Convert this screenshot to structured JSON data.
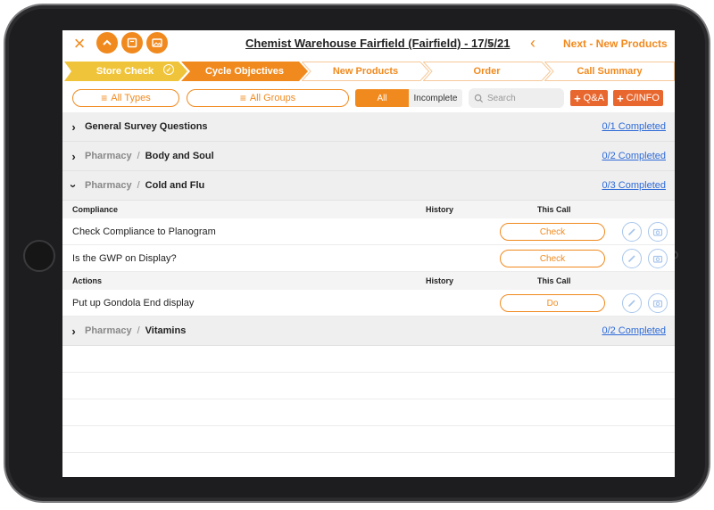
{
  "header": {
    "title": "Chemist Warehouse Fairfield (Fairfield) - 17/5/21",
    "next_label": "Next - New Products"
  },
  "steps": [
    {
      "label": "Store Check",
      "state": "done"
    },
    {
      "label": "Cycle Objectives",
      "state": "active"
    },
    {
      "label": "New Products",
      "state": "pending"
    },
    {
      "label": "Order",
      "state": "pending"
    },
    {
      "label": "Call Summary",
      "state": "pending"
    }
  ],
  "filters": {
    "types_label": "All Types",
    "groups_label": "All Groups",
    "seg_all": "All",
    "seg_incomplete": "Incomplete",
    "search_placeholder": "Search",
    "qa_label": "Q&A",
    "cinfo_label": "C/INFO"
  },
  "groups": [
    {
      "category": "",
      "name": "General Survey Questions",
      "completed": "0/1 Completed",
      "expanded": false
    },
    {
      "category": "Pharmacy",
      "name": "Body and Soul",
      "completed": "0/2 Completed",
      "expanded": false
    },
    {
      "category": "Pharmacy",
      "name": "Cold and Flu",
      "completed": "0/3 Completed",
      "expanded": true
    },
    {
      "category": "Pharmacy",
      "name": "Vitamins",
      "completed": "0/2 Completed",
      "expanded": false
    }
  ],
  "sections": [
    {
      "title": "Compliance",
      "history": "History",
      "this_call": "This Call",
      "items": [
        {
          "question": "Check Compliance to Planogram",
          "action": "Check"
        },
        {
          "question": "Is the GWP on Display?",
          "action": "Check"
        }
      ]
    },
    {
      "title": "Actions",
      "history": "History",
      "this_call": "This Call",
      "items": [
        {
          "question": "Put up Gondola End display",
          "action": "Do"
        }
      ]
    }
  ],
  "colors": {
    "accent": "#f18a1e",
    "done_step": "#f0c43a",
    "add_button": "#e8672f",
    "link": "#2d6ad7"
  }
}
